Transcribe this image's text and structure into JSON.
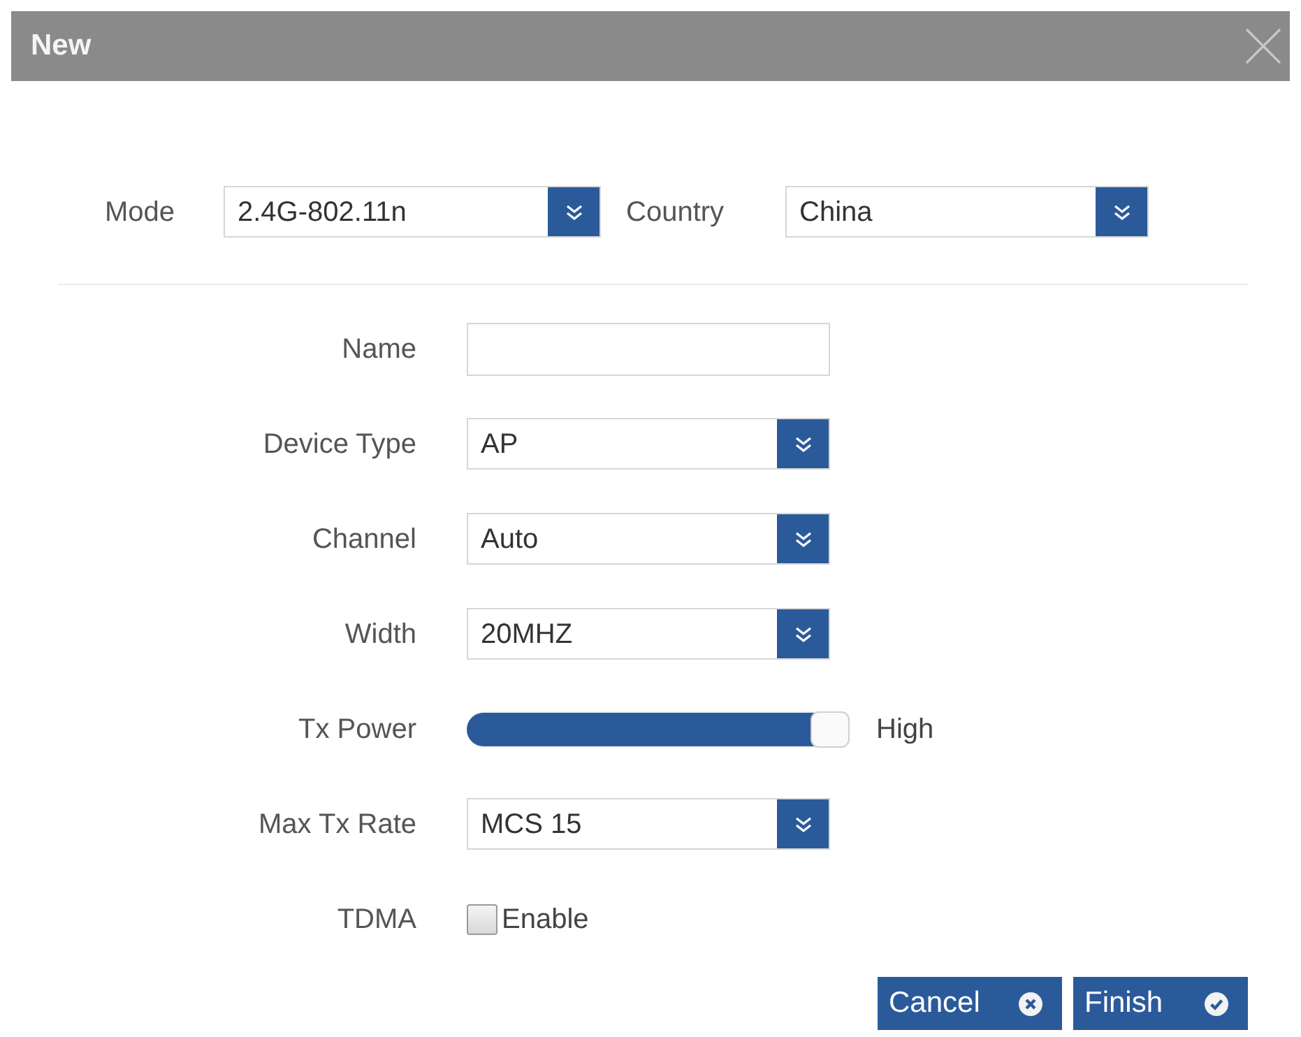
{
  "dialog": {
    "title": "New"
  },
  "top_fields": [
    {
      "label": "Mode",
      "value": "2.4G-802.11n"
    },
    {
      "label": "Country",
      "value": "China"
    }
  ],
  "fields": [
    {
      "kind": "text",
      "label": "Name"
    },
    {
      "kind": "select",
      "label": "Device Type",
      "value": "AP"
    },
    {
      "kind": "select",
      "label": "Channel",
      "value": "Auto"
    },
    {
      "kind": "select",
      "label": "Width",
      "value": "20MHZ"
    },
    {
      "kind": "slider",
      "label": "Tx Power",
      "level": 1,
      "reading": "High"
    },
    {
      "kind": "select",
      "label": "Max Tx Rate",
      "value": "MCS 15"
    },
    {
      "kind": "checkbox",
      "label": "TDMA",
      "option": "Enable",
      "checked": false
    }
  ],
  "buttons": [
    {
      "kind": "cancel",
      "label": "Cancel"
    },
    {
      "kind": "finish",
      "label": "Finish"
    }
  ]
}
